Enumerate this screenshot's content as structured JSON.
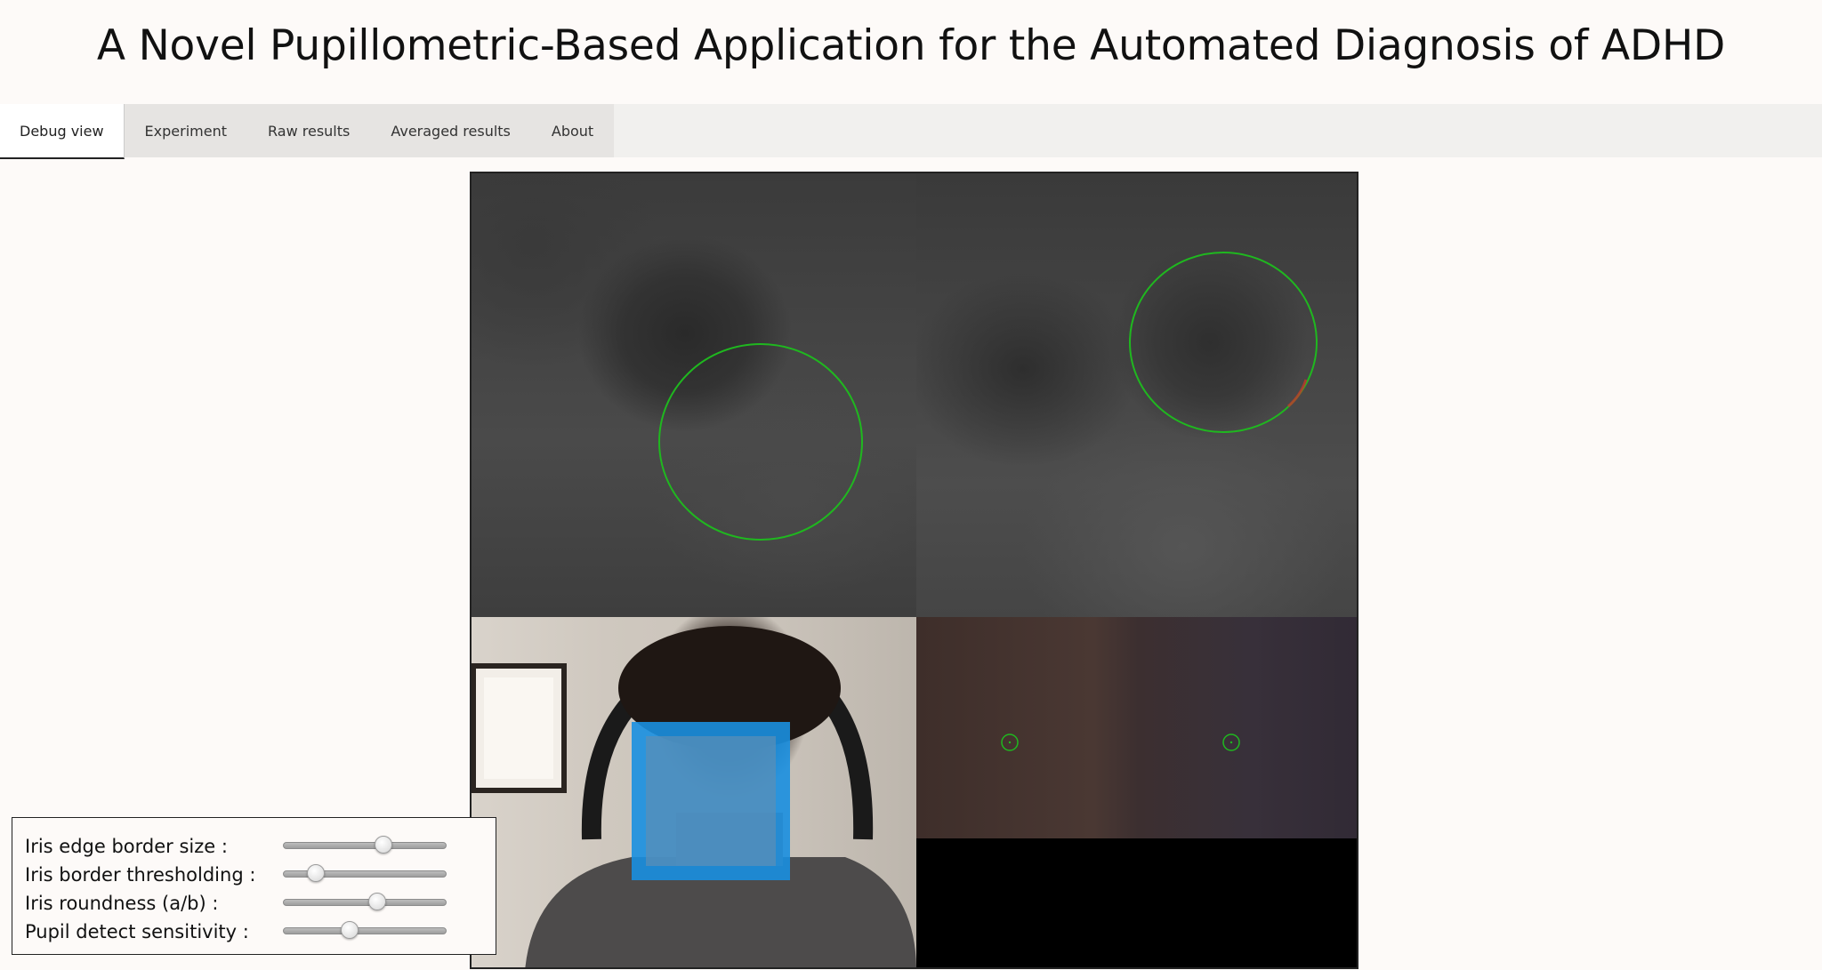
{
  "header": {
    "title": "A Novel Pupillometric-Based Application for the Automated Diagnosis of ADHD"
  },
  "tabs": [
    {
      "label": "Debug view",
      "active": true
    },
    {
      "label": "Experiment",
      "active": false
    },
    {
      "label": "Raw results",
      "active": false
    },
    {
      "label": "Averaged results",
      "active": false
    },
    {
      "label": "About",
      "active": false
    }
  ],
  "debug_view": {
    "panels": [
      "left-eye-iris-view",
      "right-eye-iris-view",
      "camera-face-view",
      "pupil-detect-views",
      "empty-panel"
    ],
    "detection_color": "#1fb81f",
    "face_box_color": "#1a8fe0"
  },
  "controls": {
    "iris_edge_border_size": {
      "label": "Iris edge border size :",
      "value": 0.62
    },
    "iris_border_thresholding": {
      "label": "Iris border thresholding :",
      "value": 0.16
    },
    "iris_roundness": {
      "label": "Iris roundness (a/b) :",
      "value": 0.58
    },
    "pupil_detect_sensitivity": {
      "label": "Pupil detect sensitivity :",
      "value": 0.39
    }
  }
}
